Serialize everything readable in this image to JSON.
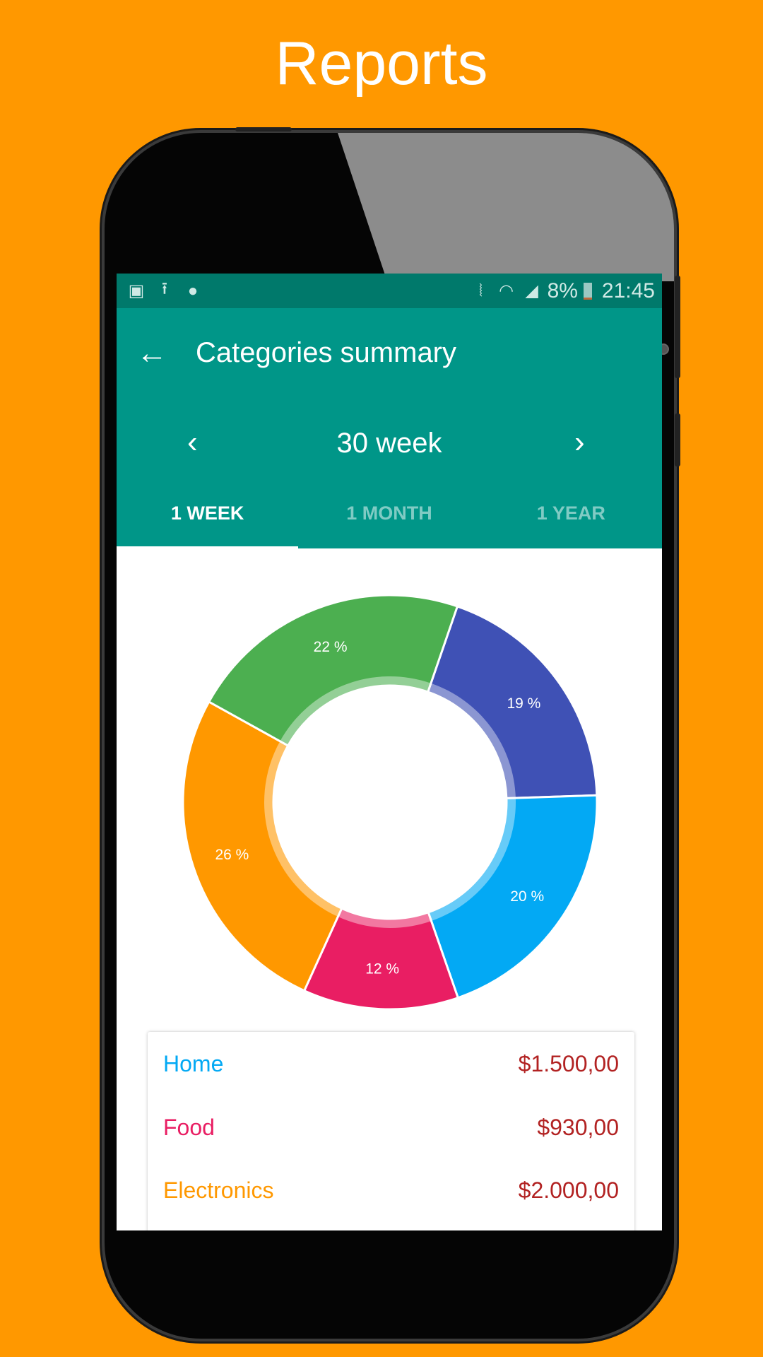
{
  "headline": "Reports",
  "status_bar": {
    "icons_left": [
      "image-icon",
      "upload-icon",
      "messenger-icon"
    ],
    "icons_right": [
      "vibrate-icon",
      "wifi-icon",
      "signal-icon"
    ],
    "battery": "8%",
    "time": "21:45"
  },
  "toolbar": {
    "back_icon": "arrow-left-icon",
    "title": "Categories summary"
  },
  "period": {
    "label": "30 week",
    "prev_icon": "chevron-left-icon",
    "next_icon": "chevron-right-icon"
  },
  "tabs": [
    {
      "label": "1 WEEK",
      "active": true
    },
    {
      "label": "1 MONTH",
      "active": false
    },
    {
      "label": "1 YEAR",
      "active": false
    }
  ],
  "chart_data": {
    "type": "pie",
    "donut": true,
    "slices": [
      {
        "label": "19 %",
        "value": 19,
        "color": "#3F51B5"
      },
      {
        "label": "20 %",
        "value": 20,
        "color": "#03A9F4"
      },
      {
        "label": "12 %",
        "value": 12,
        "color": "#E91E63"
      },
      {
        "label": "26 %",
        "value": 26,
        "color": "#FF9800"
      },
      {
        "label": "22 %",
        "value": 22,
        "color": "#4CAF50"
      }
    ]
  },
  "categories": [
    {
      "name": "Home",
      "amount": "$1.500,00",
      "color": "#03A9F4"
    },
    {
      "name": "Food",
      "amount": "$930,00",
      "color": "#E91E63"
    },
    {
      "name": "Electronics",
      "amount": "$2.000,00",
      "color": "#FF9800"
    }
  ]
}
